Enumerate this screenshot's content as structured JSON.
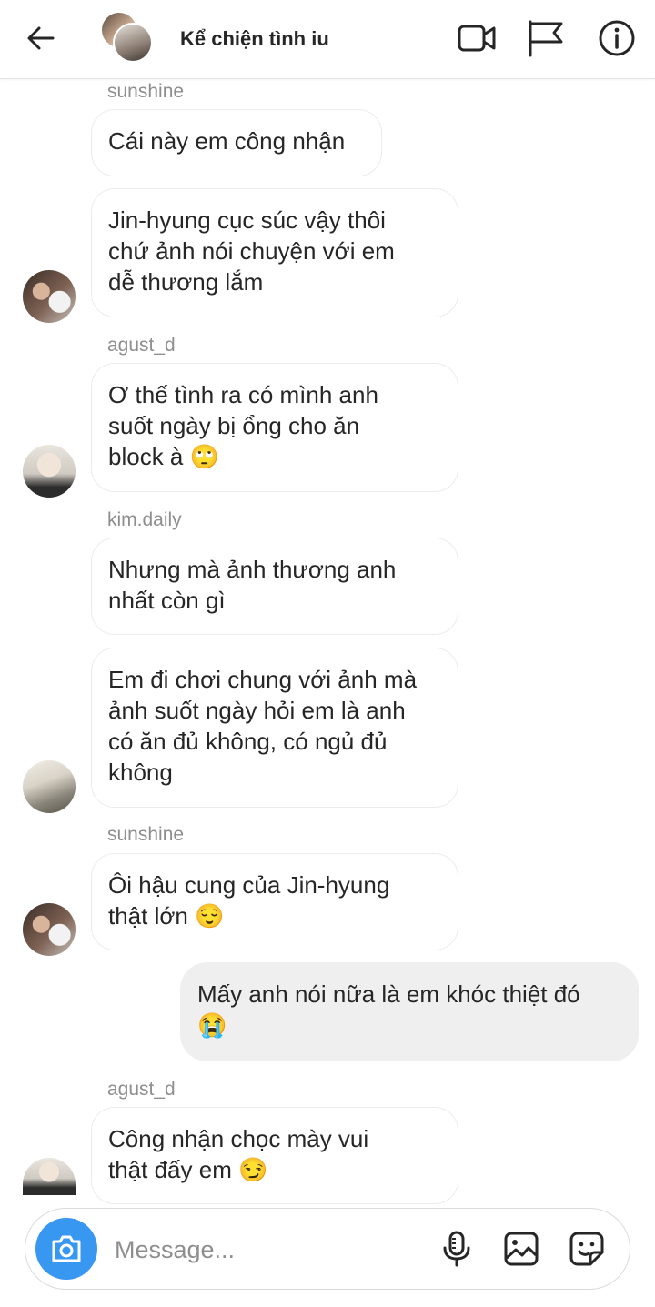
{
  "header": {
    "title": "Kể chiện tình iu"
  },
  "messages": [
    {
      "username": "sunshine",
      "text": "Cái này em công nhận"
    },
    {
      "text_lines": [
        "Jin-hyung cục súc vậy thôi",
        "chứ ảnh nói chuyện với em",
        "dễ thương lắm"
      ]
    },
    {
      "username": "agust_d",
      "text_lines": [
        "Ơ thế tình ra có mình anh",
        "suốt ngày bị ổng cho ăn",
        "block à"
      ],
      "emoji": "🙄"
    },
    {
      "username": "kim.daily",
      "text_lines": [
        "Nhưng mà ảnh thương anh",
        "nhất còn gì"
      ]
    },
    {
      "text_lines": [
        "Em đi chơi chung với ảnh mà",
        "ảnh suốt ngày hỏi em là anh",
        "có ăn đủ không, có ngủ đủ",
        "không"
      ]
    },
    {
      "username": "sunshine",
      "text_lines": [
        "Ôi hậu cung của Jin-hyung",
        "thật lớn"
      ],
      "emoji": "😌"
    },
    {
      "sender": "me",
      "text_lines": [
        "Mấy anh nói nữa là em khóc thiệt đó"
      ],
      "emoji": "😭"
    },
    {
      "username": "agust_d",
      "text_lines": [
        "Công nhận chọc mày vui",
        "thật đấy em"
      ],
      "emoji": "😏"
    }
  ],
  "composer": {
    "placeholder": "Message..."
  },
  "icons": {
    "back": "arrow-left-icon",
    "video": "video-camera-icon",
    "report": "flag-icon",
    "info": "info-icon",
    "camera": "camera-icon",
    "mic": "microphone-icon",
    "gallery": "image-icon",
    "sticker": "sticker-icon"
  },
  "colors": {
    "accent": "#3897f0",
    "own_bubble": "#efefef",
    "username": "#8e8e8e"
  }
}
